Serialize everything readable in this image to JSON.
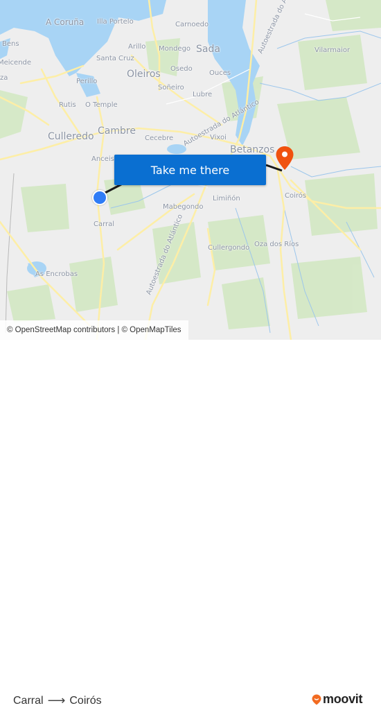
{
  "map": {
    "labels": [
      {
        "id": "a-coruna",
        "text": "A Coruña"
      },
      {
        "id": "illa-portelo",
        "text": "Illa Portelo"
      },
      {
        "id": "carnoedo",
        "text": "Carnoedo"
      },
      {
        "id": "bens",
        "text": "Bens"
      },
      {
        "id": "arillo",
        "text": "Arillo"
      },
      {
        "id": "mondego",
        "text": "Mondego"
      },
      {
        "id": "sada",
        "text": "Sada"
      },
      {
        "id": "meicende",
        "text": "Meicende"
      },
      {
        "id": "santa-cruz",
        "text": "Santa Cruz"
      },
      {
        "id": "oleiros",
        "text": "Oleiros"
      },
      {
        "id": "osedo",
        "text": "Osedo"
      },
      {
        "id": "ouces",
        "text": "Ouces"
      },
      {
        "id": "za",
        "text": "za"
      },
      {
        "id": "perillo",
        "text": "Perillo"
      },
      {
        "id": "soneiro",
        "text": "Soñeiro"
      },
      {
        "id": "lubre",
        "text": "Lubre"
      },
      {
        "id": "rutis",
        "text": "Rutis"
      },
      {
        "id": "o-temple",
        "text": "O Temple"
      },
      {
        "id": "culleredo",
        "text": "Culleredo"
      },
      {
        "id": "cambre",
        "text": "Cambre"
      },
      {
        "id": "cecebre",
        "text": "Cecebre"
      },
      {
        "id": "vixoi",
        "text": "Vixoi"
      },
      {
        "id": "betanzos",
        "text": "Betanzos"
      },
      {
        "id": "vilarmaior",
        "text": "Vilarmaior"
      },
      {
        "id": "anceis",
        "text": "Anceis"
      },
      {
        "id": "mabegondo",
        "text": "Mabegondo"
      },
      {
        "id": "liminon",
        "text": "Limiñón"
      },
      {
        "id": "coiros",
        "text": "Coirós"
      },
      {
        "id": "carral",
        "text": "Carral"
      },
      {
        "id": "cullergondo",
        "text": "Cullergondo"
      },
      {
        "id": "oza-dos-rios",
        "text": "Oza dos Ríos"
      },
      {
        "id": "as-encrobas",
        "text": "As Encrobas"
      },
      {
        "id": "autoestrada-1",
        "text": "Autoestrada do Atlántico"
      },
      {
        "id": "autoestrada-2",
        "text": "Autoestrada do Atlántico"
      },
      {
        "id": "autoestrada-3",
        "text": "Autoestrada do Atlántico"
      }
    ],
    "origin_marker": "origin-dot",
    "destination_marker": "destination-pin",
    "cta_label": "Take me there",
    "attribution": "© OpenStreetMap contributors | © OpenMapTiles"
  },
  "footer": {
    "origin": "Carral",
    "arrow": "⟶",
    "destination": "Coirós",
    "brand": "moovit"
  },
  "colors": {
    "cta": "#0a6fd1",
    "origin": "#2f7cf6",
    "destination": "#f0520f",
    "brand_pin": "#f26b21",
    "water": "#a8d4f5",
    "road": "#fdeea6",
    "forest": "#c9e3b5"
  }
}
